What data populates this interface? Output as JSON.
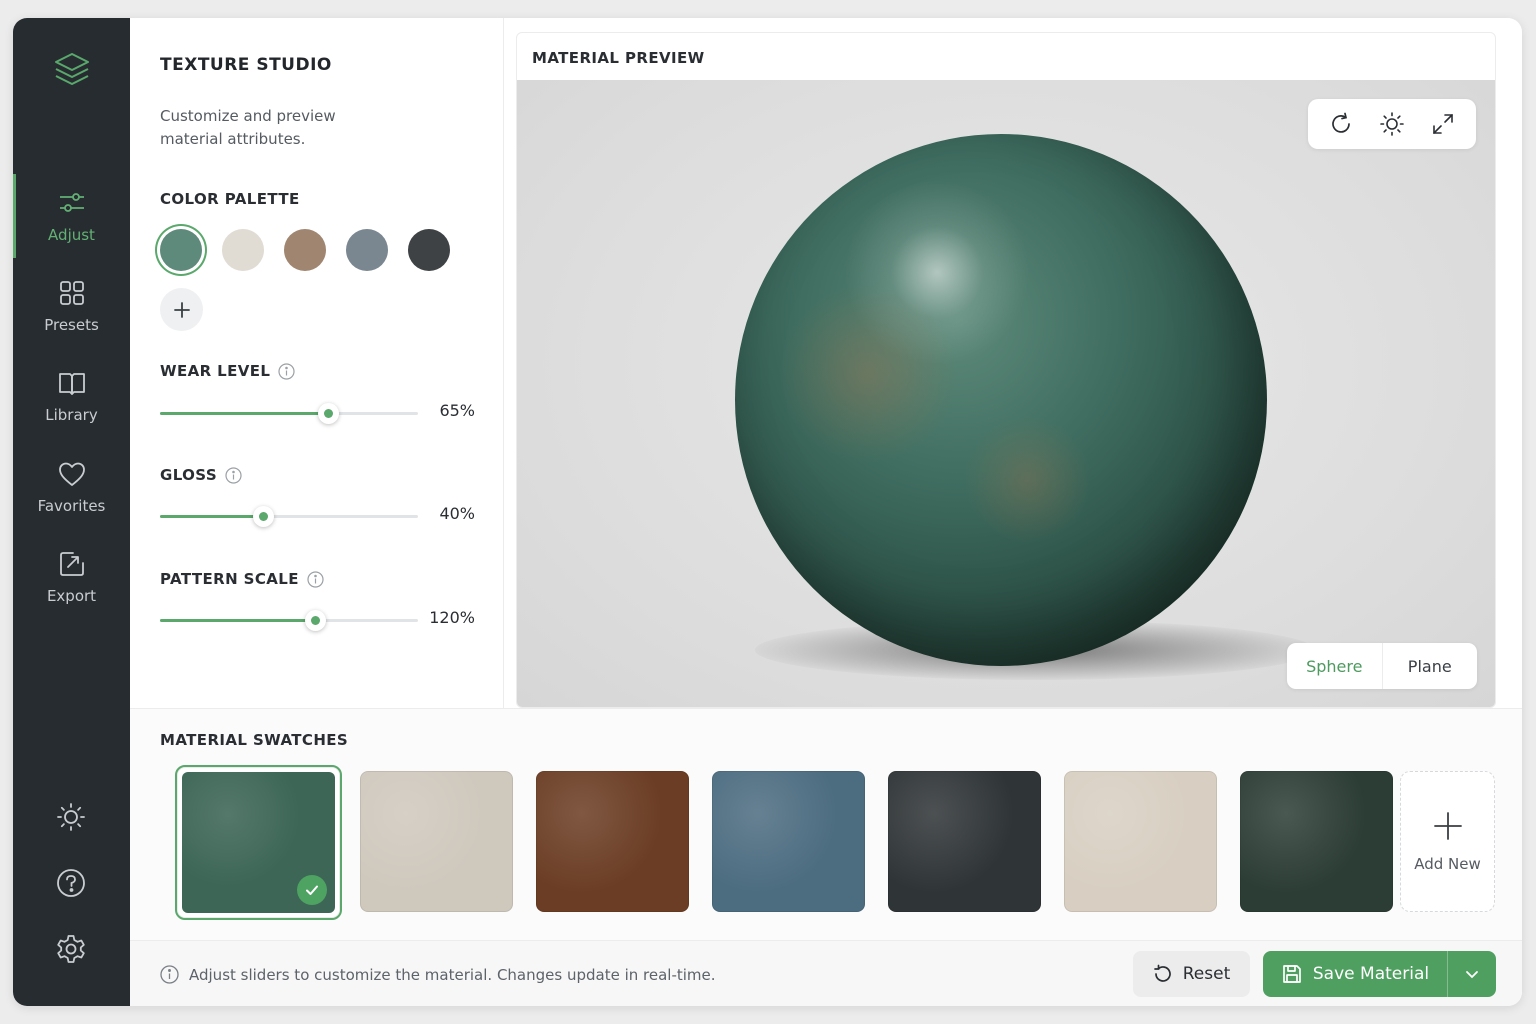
{
  "rail": {
    "logo_icon": "layers-icon",
    "items": [
      {
        "label": "Adjust",
        "icon": "sliders-icon",
        "active": true
      },
      {
        "label": "Presets",
        "icon": "grid-icon"
      },
      {
        "label": "Library",
        "icon": "book-icon"
      },
      {
        "label": "Favorites",
        "icon": "heart-icon"
      },
      {
        "label": "Export",
        "icon": "export-icon"
      }
    ],
    "bottom_icons": [
      "sun-icon",
      "help-icon",
      "gear-icon"
    ]
  },
  "panel": {
    "title": "TEXTURE STUDIO",
    "description": "Customize and preview material attributes.",
    "color_palette": {
      "label": "COLOR PALETTE",
      "colors": [
        "#5e8a7c",
        "#e0dbd3",
        "#a08670",
        "#7a8790",
        "#3e4245"
      ],
      "selected_index": 0
    },
    "sliders": [
      {
        "label": "WEAR LEVEL",
        "value": 65,
        "display": "65%"
      },
      {
        "label": "GLOSS",
        "value": 40,
        "display": "40%"
      },
      {
        "label": "PATTERN SCALE",
        "value": 120,
        "display": "120%",
        "max": 200
      }
    ]
  },
  "preview": {
    "title": "MATERIAL PREVIEW",
    "tools": [
      "rotate-icon",
      "light-icon",
      "expand-icon"
    ],
    "shapes": [
      "Sphere",
      "Plane"
    ],
    "active_shape": "Sphere"
  },
  "swatches": {
    "title": "MATERIAL SWATCHES",
    "items": [
      {
        "color": "#3d6656",
        "selected": true
      },
      {
        "color": "#cfc8bd"
      },
      {
        "color": "#6b3d24"
      },
      {
        "color": "#4c6c80"
      },
      {
        "color": "#2f3436"
      },
      {
        "color": "#d8cfc2"
      },
      {
        "color": "#2c3d35"
      }
    ],
    "add_label": "Add New"
  },
  "footer": {
    "hint": "Adjust sliders to customize the material. Changes update in real-time.",
    "reset_label": "Reset",
    "save_label": "Save Material"
  },
  "colors": {
    "accent": "#5aa86b",
    "rail_bg": "#272c30"
  }
}
